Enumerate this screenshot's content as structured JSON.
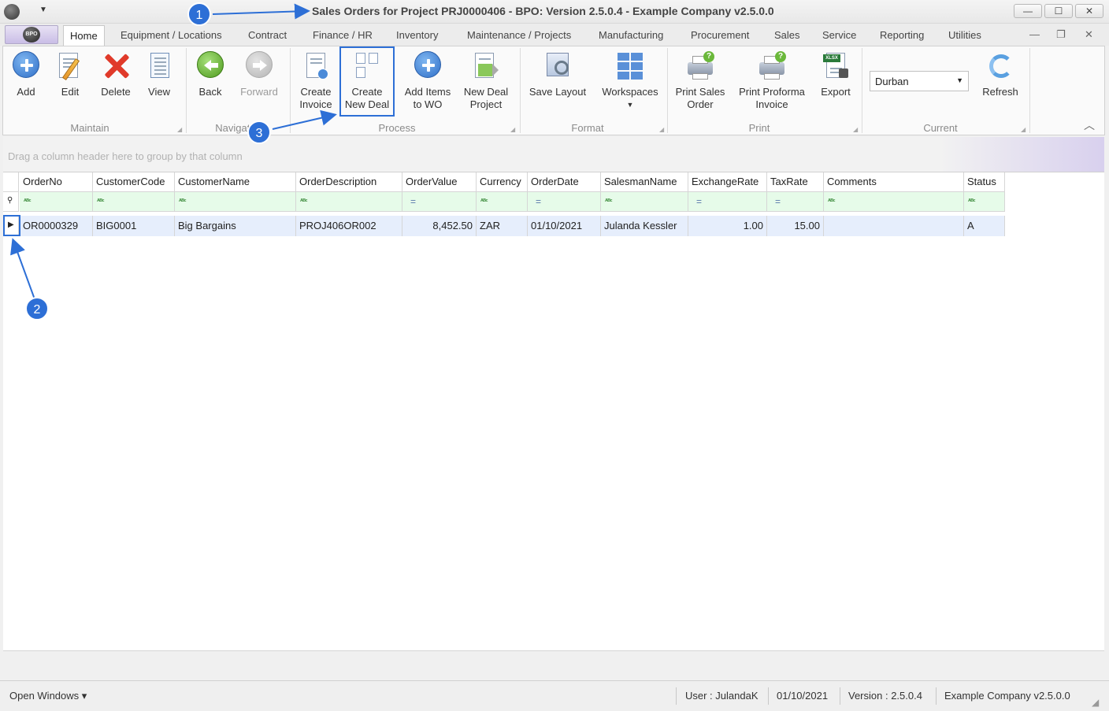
{
  "window": {
    "title": "Sales Orders for Project PRJ0000406 - BPO: Version 2.5.0.4 - Example Company v2.5.0.0",
    "minimize": "—",
    "maximize": "☐",
    "close": "✕"
  },
  "app_logo": "BPO",
  "tabs": [
    "Home",
    "Equipment / Locations",
    "Contract",
    "Finance / HR",
    "Inventory",
    "Maintenance / Projects",
    "Manufacturing",
    "Procurement",
    "Sales",
    "Service",
    "Reporting",
    "Utilities"
  ],
  "ribbon": {
    "maintain": {
      "label": "Maintain",
      "add": "Add",
      "edit": "Edit",
      "delete": "Delete",
      "view": "View"
    },
    "navigation": {
      "label": "Navigation",
      "back": "Back",
      "forward": "Forward"
    },
    "process": {
      "label": "Process",
      "create_invoice_1": "Create",
      "create_invoice_2": "Invoice",
      "create_deal_1": "Create",
      "create_deal_2": "New Deal",
      "add_items_1": "Add Items",
      "add_items_2": "to WO",
      "new_deal_1": "New Deal",
      "new_deal_2": "Project"
    },
    "format": {
      "label": "Format",
      "save_layout": "Save Layout",
      "workspaces": "Workspaces"
    },
    "print": {
      "label": "Print",
      "print_so_1": "Print Sales",
      "print_so_2": "Order",
      "print_pi_1": "Print Proforma",
      "print_pi_2": "Invoice",
      "export": "Export"
    },
    "current": {
      "label": "Current",
      "site": "Durban",
      "refresh": "Refresh"
    }
  },
  "grid": {
    "group_hint": "Drag a column header here to group by that column",
    "columns": [
      "OrderNo",
      "CustomerCode",
      "CustomerName",
      "OrderDescription",
      "OrderValue",
      "Currency",
      "OrderDate",
      "SalesmanName",
      "ExchangeRate",
      "TaxRate",
      "Comments",
      "Status"
    ],
    "rows": [
      [
        "OR0000329",
        "BIG0001",
        "Big Bargains",
        "PROJ406OR002",
        "8,452.50",
        "ZAR",
        "01/10/2021",
        "Julanda Kessler",
        "1.00",
        "15.00",
        "",
        "A"
      ]
    ]
  },
  "status": {
    "open_windows": "Open Windows ▾",
    "user": "User : JulandaK",
    "date": "01/10/2021",
    "version": "Version : 2.5.0.4",
    "company": "Example Company v2.5.0.0"
  },
  "callouts": [
    "1",
    "2",
    "3"
  ],
  "colors": {
    "accent": "#2d6fd6",
    "filter_row": "#e6fbe9",
    "selected_row": "#e6eefc"
  }
}
